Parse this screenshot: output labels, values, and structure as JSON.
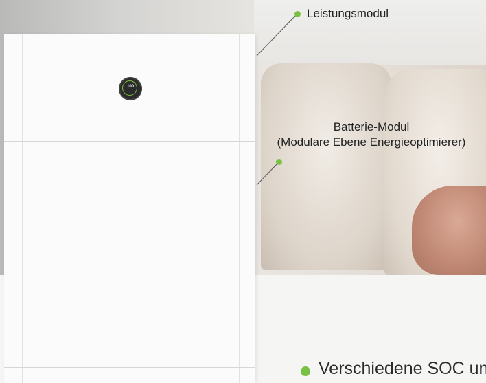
{
  "display": {
    "percentage": "100"
  },
  "callouts": {
    "power_module": "Leistungsmodul",
    "battery_module_line1": "Batterie-Modul",
    "battery_module_line2": "(Modulare Ebene Energieoptimierer)"
  },
  "bullet": {
    "text": "Verschiedene SOC un"
  },
  "colors": {
    "accent": "#7ac143"
  }
}
